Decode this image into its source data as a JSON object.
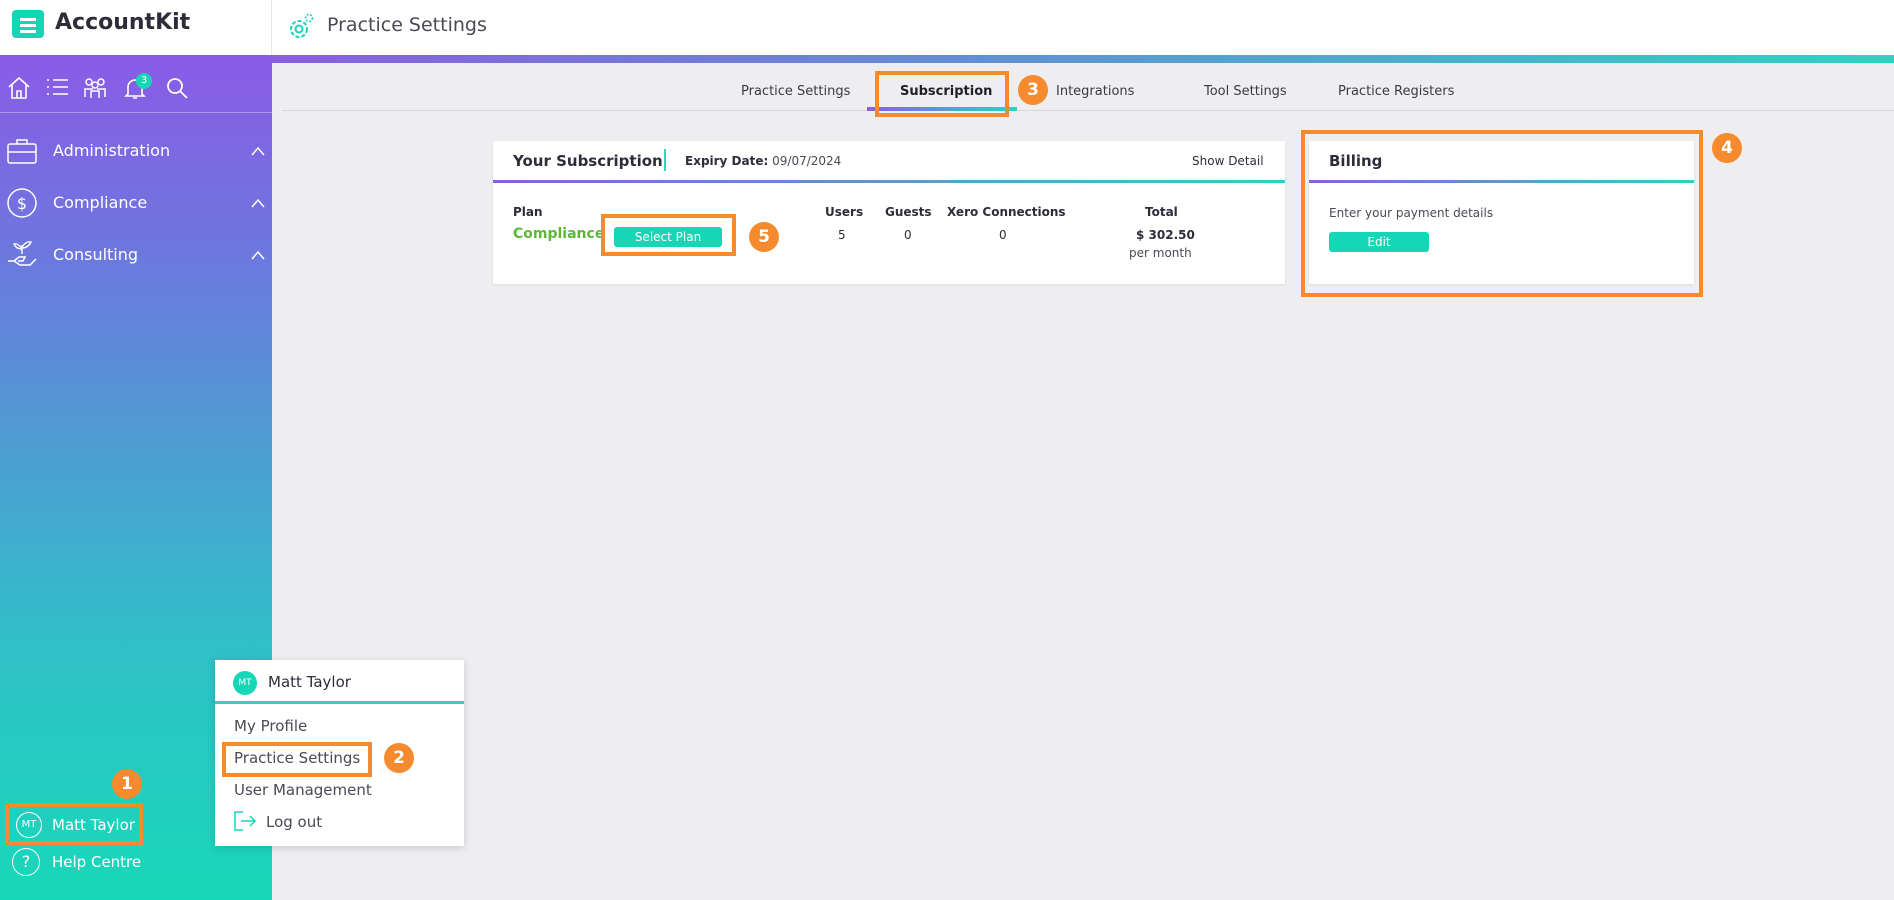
{
  "app": {
    "name": "AccountKit"
  },
  "header": {
    "title": "Practice Settings"
  },
  "sidebar": {
    "notification_count": "3",
    "items": [
      {
        "label": "Administration"
      },
      {
        "label": "Compliance"
      },
      {
        "label": "Consulting"
      }
    ],
    "user": {
      "initials": "MT",
      "name": "Matt Taylor"
    },
    "help": {
      "label": "Help Centre",
      "icon_glyph": "?"
    }
  },
  "user_menu": {
    "initials": "MT",
    "name": "Matt Taylor",
    "items": [
      "My Profile",
      "Practice Settings",
      "User Management",
      "Log out"
    ]
  },
  "tabs": [
    {
      "label": "Practice Settings"
    },
    {
      "label": "Subscription",
      "active": true
    },
    {
      "label": "Integrations"
    },
    {
      "label": "Tool Settings"
    },
    {
      "label": "Practice Registers"
    }
  ],
  "subscription": {
    "title": "Your Subscription",
    "expiry_label": "Expiry Date:",
    "expiry_value": "09/07/2024",
    "show_detail": "Show Detail",
    "columns": {
      "plan": "Plan",
      "users": "Users",
      "guests": "Guests",
      "xero": "Xero Connections",
      "total": "Total"
    },
    "plan_name": "Compliance",
    "select_plan_label": "Select Plan",
    "users": "5",
    "guests": "0",
    "xero": "0",
    "total": "$ 302.50",
    "total_period": "per month"
  },
  "billing": {
    "title": "Billing",
    "text": "Enter your payment details",
    "edit_label": "Edit"
  },
  "annotations": [
    "1",
    "2",
    "3",
    "4",
    "5"
  ],
  "colors": {
    "accent_teal": "#16d6b6",
    "highlight_orange": "#f58a2e",
    "plan_green": "#5db838",
    "sidebar_top": "#8a5be6"
  }
}
